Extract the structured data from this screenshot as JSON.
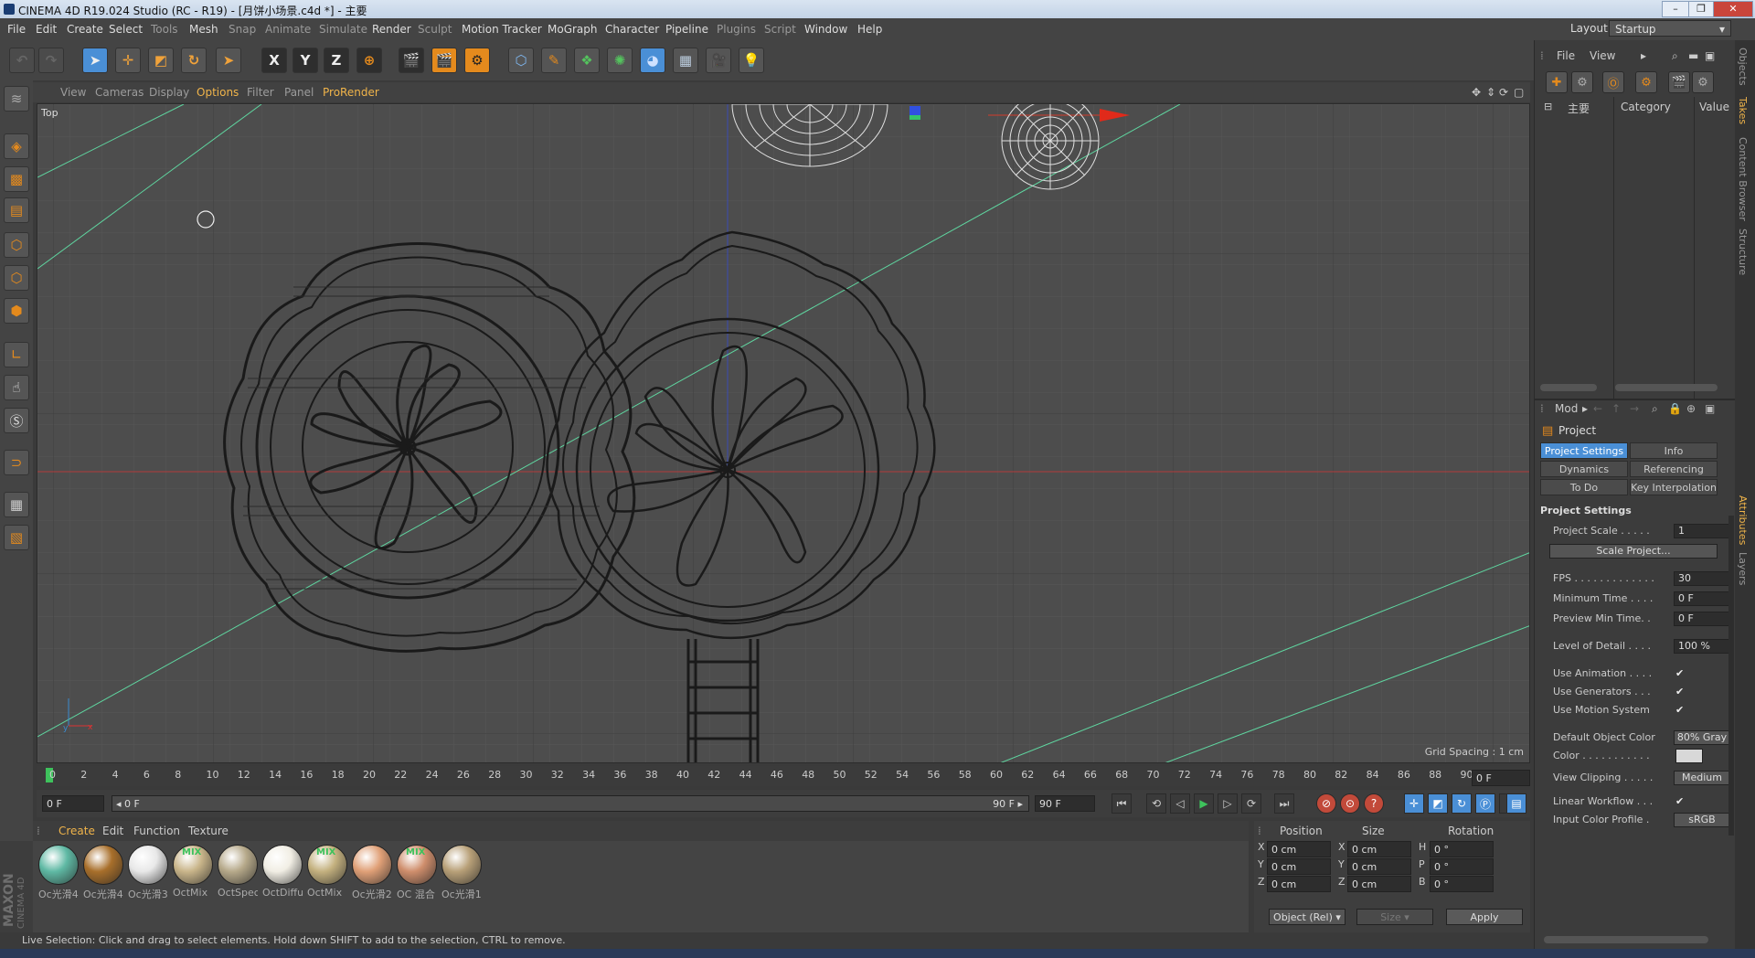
{
  "window": {
    "title": "CINEMA 4D R19.024 Studio (RC - R19) - [月饼小场景.c4d *] - 主要",
    "buttons": [
      "–",
      "❐",
      "✕"
    ]
  },
  "menubar": {
    "items": [
      "File",
      "Edit",
      "Create",
      "Select",
      "Tools",
      "Mesh",
      "Snap",
      "Animate",
      "Simulate",
      "Render",
      "Sculpt",
      "Motion Tracker",
      "MoGraph",
      "Character",
      "Pipeline",
      "Plugins",
      "Script",
      "Window",
      "Help"
    ],
    "layout_label": "Layout:",
    "layout_value": "Startup"
  },
  "toolbar": {
    "axis_x": "X",
    "axis_y": "Y",
    "axis_z": "Z"
  },
  "viewport": {
    "menu": [
      "View",
      "Cameras",
      "Display",
      "Options",
      "Filter",
      "Panel",
      "ProRender"
    ],
    "active_menu": "Options",
    "label": "Top",
    "grid_spacing": "Grid Spacing : 1 cm",
    "axis_x": "x",
    "axis_y": "y"
  },
  "timeline": {
    "ticks": [
      "0",
      "2",
      "4",
      "6",
      "8",
      "10",
      "12",
      "14",
      "16",
      "18",
      "20",
      "22",
      "24",
      "26",
      "28",
      "30",
      "32",
      "34",
      "36",
      "38",
      "40",
      "42",
      "44",
      "46",
      "48",
      "50",
      "52",
      "54",
      "56",
      "58",
      "60",
      "62",
      "64",
      "66",
      "68",
      "70",
      "72",
      "74",
      "76",
      "78",
      "80",
      "82",
      "84",
      "86",
      "88",
      "90"
    ],
    "current_frame": "0 F",
    "start_field": "0 F",
    "slider_start": "◂ 0 F",
    "slider_end": "90 F ▸",
    "end_field": "90 F"
  },
  "materials": {
    "menu": [
      "Create",
      "Edit",
      "Function",
      "Texture"
    ],
    "items": [
      {
        "label": "Oc光滑4",
        "color": "#5fb9a4"
      },
      {
        "label": "Oc光滑4",
        "color": "#a86f2b"
      },
      {
        "label": "Oc光滑3",
        "color": "#e8e8e8"
      },
      {
        "label": "OctMix",
        "color": "#c9b58a",
        "mix": "MIX"
      },
      {
        "label": "OctSpec",
        "color": "#b6a98a"
      },
      {
        "label": "OctDiffu",
        "color": "#f1eee4"
      },
      {
        "label": "OctMix",
        "color": "#c4b17f",
        "mix": "MIX"
      },
      {
        "label": "Oc光滑2",
        "color": "#e0a077"
      },
      {
        "label": "OC 混合",
        "color": "#cf8e6c",
        "mix": "MIX"
      },
      {
        "label": "Oc光滑1",
        "color": "#b8a078"
      }
    ],
    "brand_top": "MAXON",
    "brand_bottom": "CINEMA 4D"
  },
  "coords": {
    "headers": [
      "Position",
      "Size",
      "Rotation"
    ],
    "rows": [
      {
        "axis": "X",
        "pos": "0 cm",
        "saxis": "X",
        "size": "0 cm",
        "raxis": "H",
        "rot": "0 °"
      },
      {
        "axis": "Y",
        "pos": "0 cm",
        "saxis": "Y",
        "size": "0 cm",
        "raxis": "P",
        "rot": "0 °"
      },
      {
        "axis": "Z",
        "pos": "0 cm",
        "saxis": "Z",
        "size": "0 cm",
        "raxis": "B",
        "rot": "0 °"
      }
    ],
    "mode": "Object (Rel)",
    "size_mode": "Size",
    "apply": "Apply"
  },
  "status": "Live Selection: Click and drag to select elements. Hold down SHIFT to add to the selection, CTRL to remove.",
  "objects_panel": {
    "menu": [
      "File",
      "View"
    ],
    "root": "主要",
    "col_category": "Category",
    "col_value": "Value"
  },
  "side_tabs": [
    "Objects",
    "Takes",
    "Content Browser",
    "Structure",
    "Attributes",
    "Layers"
  ],
  "attributes": {
    "mode": "Mod",
    "title": "Project",
    "tabs": [
      "Project Settings",
      "Info",
      "Dynamics",
      "Referencing",
      "To Do",
      "Key Interpolation"
    ],
    "section": "Project Settings",
    "project_scale_label": "Project Scale . . . . . .",
    "project_scale": "1",
    "scale_project_btn": "Scale Project...",
    "fps_label": "FPS . . . . . . . . . . . . . .",
    "fps": "30",
    "min_time_label": "Minimum Time . . . . .",
    "min_time": "0 F",
    "preview_min_label": "Preview Min Time. . .",
    "preview_min": "0 F",
    "lod_label": "Level of Detail . . . . .",
    "lod": "100 %",
    "use_animation": "Use Animation . . . . .",
    "use_generators": "Use Generators . . . .",
    "use_motion": "Use Motion System",
    "default_color_label": "Default Object Color",
    "default_color": "80% Gray",
    "color_label": "Color . . . . . . . . . . .",
    "view_clipping_label": "View Clipping . . . . .",
    "view_clipping": "Medium",
    "linear_workflow": "Linear Workflow . . .",
    "input_color_label": "Input Color Profile . .",
    "input_color": "sRGB"
  }
}
